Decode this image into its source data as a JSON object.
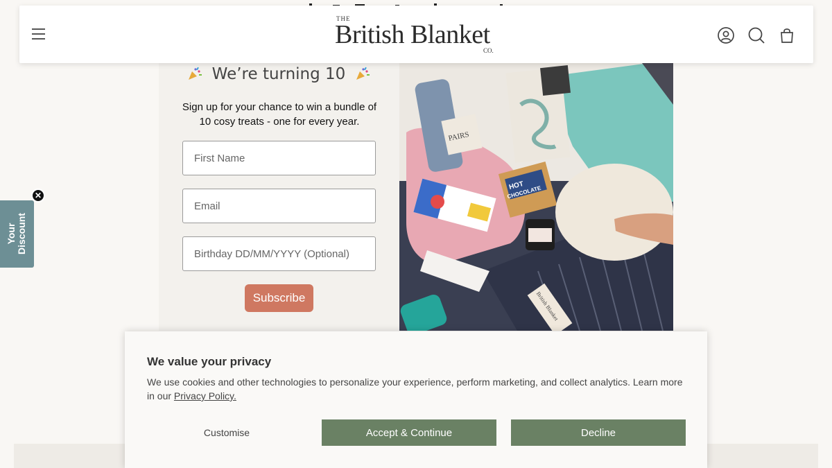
{
  "header": {
    "logo_the": "THE",
    "logo_main": "British Blanket",
    "logo_co": "CO."
  },
  "popup": {
    "title": "We’re turning 10",
    "description": "Sign up for your chance to win a bundle of 10 cosy treats - one for every year.",
    "first_name_placeholder": "First Name",
    "email_placeholder": "Email",
    "birthday_placeholder": "Birthday DD/MM/YYYY (Optional)",
    "subscribe_label": "Subscribe",
    "photo_labels": {
      "socks": "PAIRS",
      "chocolate_line1": "HOT",
      "chocolate_line2": "CHOCOLATE",
      "blanket_tag": "British Blanket"
    }
  },
  "discount_tab": {
    "label_line1": "Your",
    "label_line2": "Discount",
    "close_glyph": "✕"
  },
  "cookie_banner": {
    "title": "We value your privacy",
    "text": "We use cookies and other technologies to personalize your experience, perform marketing, and collect analytics. Learn more in our ",
    "link_text": "Privacy Policy.",
    "customise_label": "Customise",
    "accept_label": "Accept & Continue",
    "decline_label": "Decline"
  },
  "colors": {
    "subscribe": "#cf7861",
    "discount_tab": "#6d8f95",
    "cookie_button": "#6a8164"
  }
}
